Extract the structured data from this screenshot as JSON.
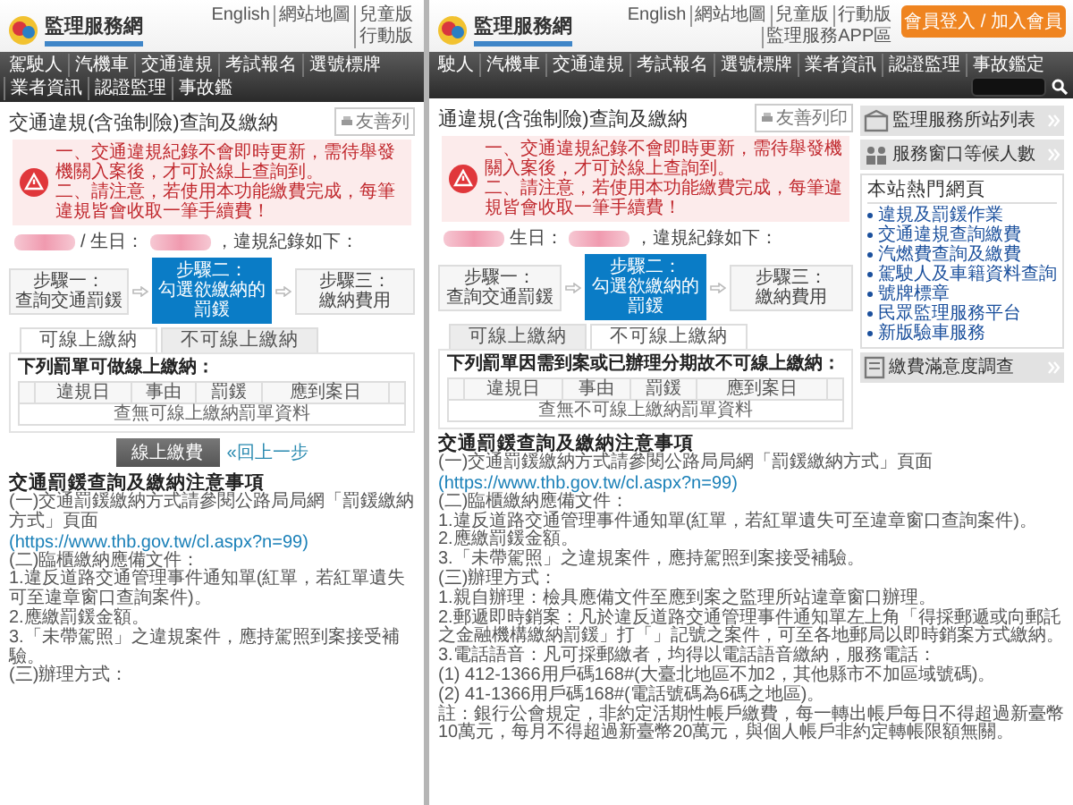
{
  "panels": [
    {
      "header": {
        "logo": "監理服務網",
        "links": [
          "English",
          "網站地圖",
          "兒童版",
          "行動版"
        ]
      },
      "nav": {
        "items": [
          "駕駛人",
          "汽機車",
          "交通違規",
          "考試報名",
          "選號標牌",
          "業者資訊",
          "認證監理",
          "事故鑑"
        ]
      },
      "page_title": "交通違規(含強制險)查詢及繳納",
      "print_button": "友善列",
      "alert": {
        "lines": [
          "一、交通違規紀錄不會即時更新，需待舉發機關入案後，才可於線上查詢到。",
          "二、請注意，若使用本功能繳費完成，每筆違規皆會收取一筆手續費！"
        ]
      },
      "record_line": {
        "birthday_label": "/ 生日：",
        "suffix": "，違規紀錄如下："
      },
      "steps": [
        {
          "title": "步驟一：",
          "text": "查詢交通罰鍰",
          "selected": false
        },
        {
          "title": "步驟二：",
          "text": "勾選欲繳納的罰鍰",
          "selected": true
        },
        {
          "title": "步驟三：",
          "text": "繳納費用",
          "selected": false
        }
      ],
      "tabs": [
        {
          "label": "可線上繳納",
          "selected": true
        },
        {
          "label": "不可線上繳納",
          "selected": false
        }
      ],
      "table": {
        "heading": "下列罰單可做線上繳納：",
        "columns": [
          "違規日",
          "事由",
          "罰鍰",
          "應到案日"
        ],
        "empty_message": "查無可線上繳納罰單資料"
      },
      "actions": {
        "pay_button": "線上繳費",
        "back_link": "«回上一步"
      },
      "notes": {
        "title": "交通罰鍰查詢及繳納注意事項",
        "paragraphs": [
          {
            "kind": "text",
            "text": "(一)交通罰鍰繳納方式請參閱公路局局網「罰鍰繳納方式」頁面"
          },
          {
            "kind": "link",
            "text": "(https://www.thb.gov.tw/cl.aspx?n=99)"
          },
          {
            "kind": "text",
            "text": "(二)臨櫃繳納應備文件："
          },
          {
            "kind": "text",
            "text": "1.違反道路交通管理事件通知單(紅單，若紅單遺失可至違章窗口查詢案件)。"
          },
          {
            "kind": "text",
            "text": "2.應繳罰鍰金額。"
          },
          {
            "kind": "text",
            "text": "3.「未帶駕照」之違規案件，應持駕照到案接受補驗。"
          },
          {
            "kind": "text",
            "text": "(三)辦理方式："
          }
        ]
      }
    },
    {
      "header": {
        "logo": "監理服務網",
        "links": [
          "English",
          "網站地圖",
          "兒童版",
          "行動版",
          "監理服務APP區"
        ],
        "member_button": "會員登入 / 加入會員"
      },
      "nav": {
        "items": [
          "駛人",
          "汽機車",
          "交通違規",
          "考試報名",
          "選號標牌",
          "業者資訊",
          "認證監理",
          "事故鑑定"
        ],
        "has_search": true
      },
      "page_title": "通違規(含強制險)查詢及繳納",
      "print_button": "友善列印",
      "alert": {
        "lines": [
          "一、交通違規紀錄不會即時更新，需待舉發機關入案後，才可於線上查詢到。",
          "二、請注意，若使用本功能繳費完成，每筆違規皆會收取一筆手續費！"
        ]
      },
      "record_line": {
        "birthday_label": "生日：",
        "suffix": "，違規紀錄如下："
      },
      "steps": [
        {
          "title": "步驟一：",
          "text": "查詢交通罰鍰",
          "selected": false
        },
        {
          "title": "步驟二：",
          "text": "勾選欲繳納的罰鍰",
          "selected": true
        },
        {
          "title": "步驟三：",
          "text": "繳納費用",
          "selected": false
        }
      ],
      "tabs": [
        {
          "label": "可線上繳納",
          "selected": false
        },
        {
          "label": "不可線上繳納",
          "selected": true
        }
      ],
      "table": {
        "heading": "下列罰單因需到案或已辦理分期故不可線上繳納：",
        "columns": [
          "違規日",
          "事由",
          "罰鍰",
          "應到案日"
        ],
        "empty_message": "查無不可線上繳納罰單資料"
      },
      "sidebar": {
        "top_buttons": [
          {
            "kind": "stations",
            "label": "監理服務所站列表"
          },
          {
            "kind": "queue",
            "label": "服務窗口等候人數"
          }
        ],
        "hot_heading": "本站熱門網頁",
        "hot_items": [
          "違規及罰鍰作業",
          "交通違規查詢繳費",
          "汽燃費查詢及繳費",
          "駕駛人及車籍資料查詢",
          "號牌標章",
          "民眾監理服務平台",
          "新版驗車服務"
        ],
        "survey_button": "繳費滿意度調查"
      },
      "notes": {
        "title": "交通罰鍰查詢及繳納注意事項",
        "paragraphs": [
          {
            "kind": "text",
            "text": "(一)交通罰鍰繳納方式請參閱公路局局網「罰鍰繳納方式」頁面"
          },
          {
            "kind": "link",
            "text": "(https://www.thb.gov.tw/cl.aspx?n=99)"
          },
          {
            "kind": "text",
            "text": "(二)臨櫃繳納應備文件："
          },
          {
            "kind": "text",
            "text": "1.違反道路交通管理事件通知單(紅單，若紅單遺失可至違章窗口查詢案件)。"
          },
          {
            "kind": "text",
            "text": "2.應繳罰鍰金額。"
          },
          {
            "kind": "text",
            "text": "3.「未帶駕照」之違規案件，應持駕照到案接受補驗。"
          },
          {
            "kind": "text",
            "text": "(三)辦理方式："
          },
          {
            "kind": "text",
            "text": "1.親自辦理：檢具應備文件至應到案之監理所站違章窗口辦理。"
          },
          {
            "kind": "text",
            "text": "2.郵遞即時銷案：凡於違反道路交通管理事件通知單左上角「得採郵遞或向郵託之金融機構繳納罰鍰」打「」記號之案件，可至各地郵局以即時銷案方式繳納。"
          },
          {
            "kind": "text",
            "text": "3.電話語音：凡可採郵繳者，均得以電話語音繳納，服務電話："
          },
          {
            "kind": "text",
            "text": "(1) 412-1366用戶碼168#(大臺北地區不加2，其他縣市不加區域號碼)。"
          },
          {
            "kind": "text",
            "text": "(2) 41-1366用戶碼168#(電話號碼為6碼之地區)。"
          },
          {
            "kind": "text",
            "text": "註：銀行公會規定，非約定活期性帳戶繳費，每一轉出帳戶每日不得超過新臺幣10萬元，每月不得超過新臺幣20萬元，與個人帳戶非約定轉帳限額無關。"
          }
        ]
      }
    }
  ]
}
